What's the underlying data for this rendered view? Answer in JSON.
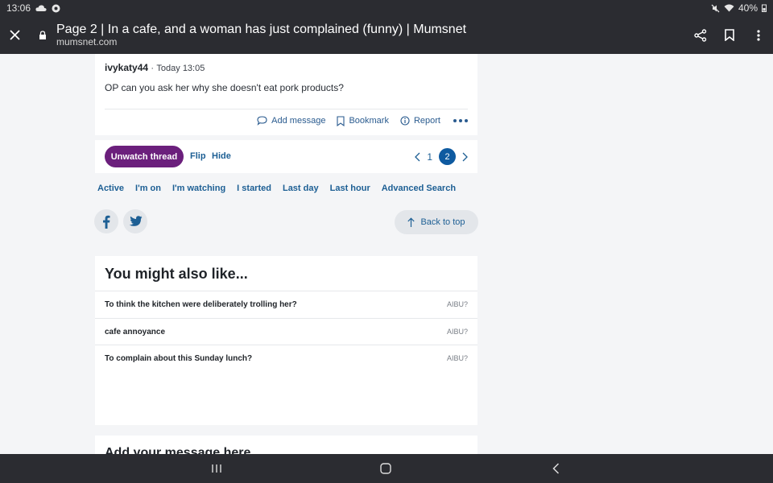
{
  "status_bar": {
    "time": "13:06",
    "battery": "40%"
  },
  "browser": {
    "title": "Page 2 | In a cafe, and a woman has just complained (funny) | Mumsnet",
    "domain": "mumsnet.com"
  },
  "post": {
    "author": "ivykaty44",
    "separator": "·",
    "time": "Today 13:05",
    "body": "OP can you ask her why she doesn't eat pork products?",
    "actions": {
      "add_message": "Add message",
      "bookmark": "Bookmark",
      "report": "Report"
    }
  },
  "thread_bar": {
    "unwatch": "Unwatch thread",
    "flip": "Flip",
    "hide": "Hide",
    "pages": [
      "1",
      "2"
    ],
    "current_page": "2"
  },
  "filters": [
    "Active",
    "I'm on",
    "I'm watching",
    "I started",
    "Last day",
    "Last hour",
    "Advanced Search"
  ],
  "back_to_top": "Back to top",
  "also_like": {
    "title": "You might also like...",
    "items": [
      {
        "title": "To think the kitchen were deliberately trolling her?",
        "tag": "AIBU?"
      },
      {
        "title": "cafe annoyance",
        "tag": "AIBU?"
      },
      {
        "title": "To complain about this Sunday lunch?",
        "tag": "AIBU?"
      }
    ]
  },
  "add_message_title": "Add your message here",
  "icons": {
    "close": "close-icon",
    "lock": "lock-icon",
    "share": "share-icon",
    "bookmark": "bookmark-icon",
    "menu": "more-vert-icon",
    "facebook": "facebook-icon",
    "twitter": "twitter-icon",
    "arrow_up": "arrow-up-icon",
    "nav_recents": "recents-icon",
    "nav_home": "home-icon",
    "nav_back": "back-icon"
  },
  "colors": {
    "brand_purple": "#6b1f7c",
    "link_blue": "#1d5f94",
    "page_active": "#0e5aa0",
    "chrome": "#2b2c31"
  }
}
